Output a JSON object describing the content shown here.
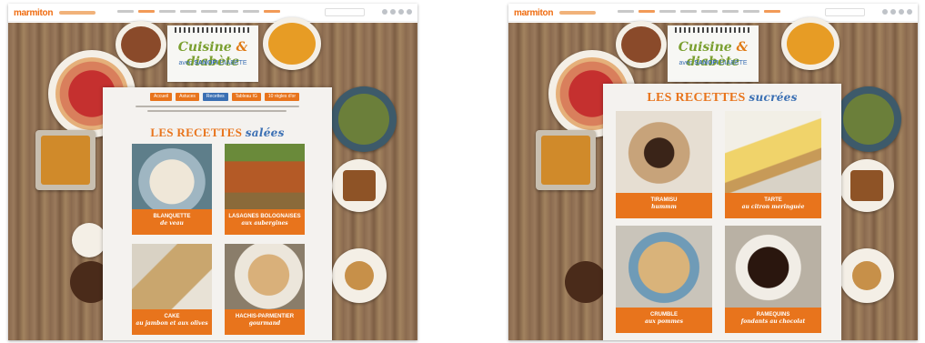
{
  "brand": {
    "logo": "marmiton"
  },
  "notebook": {
    "title_part1": "Cuisine",
    "title_amp": "&",
    "title_part2": "diabète",
    "subtitle_prefix": "avec",
    "subtitle_brand": "SANOFI",
    "subtitle_suffix": "DIABÈTE"
  },
  "colors": {
    "accent": "#e8741c",
    "blue": "#3a6fb3",
    "green": "#7a9f2f"
  },
  "left": {
    "tabs": [
      {
        "label": "Accueil",
        "active": false
      },
      {
        "label": "Astuces",
        "active": false
      },
      {
        "label": "Recettes",
        "active": true
      },
      {
        "label": "Tableau IG",
        "active": false
      },
      {
        "label": "10 règles d'or",
        "active": false
      }
    ],
    "heading": "LES RECETTES",
    "heading_em": "salées",
    "cards": [
      {
        "line1": "BLANQUETTE",
        "line2": "de veau"
      },
      {
        "line1": "LASAGNES BOLOGNAISES",
        "line2": "aux aubergines"
      },
      {
        "line1": "CAKE",
        "line2": "au jambon et aux olives"
      },
      {
        "line1": "HACHIS-PARMENTIER",
        "line2": "gourmand"
      }
    ]
  },
  "right": {
    "heading": "LES RECETTES",
    "heading_em": "sucrées",
    "cards": [
      {
        "line1": "TIRAMISU",
        "line2": "hummm"
      },
      {
        "line1": "TARTE",
        "line2": "au citron meringuée"
      },
      {
        "line1": "CRUMBLE",
        "line2": "aux pommes"
      },
      {
        "line1": "RAMEQUINS",
        "line2": "fondants au chocolat"
      }
    ]
  }
}
